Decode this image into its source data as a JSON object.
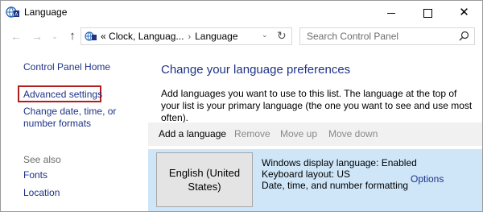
{
  "window": {
    "title": "Language",
    "controls": {
      "minimize": "",
      "maximize": "",
      "close": "✕"
    }
  },
  "navigation": {
    "back": "←",
    "forward": "→",
    "recent": "⌄",
    "up": "↑",
    "address": {
      "prefix": "«",
      "crumbs": [
        "Clock, Languag...",
        "Language"
      ],
      "separator": "›",
      "dropdown": "⌄",
      "refresh": "↻"
    },
    "search": {
      "placeholder": "Search Control Panel"
    }
  },
  "sidebar": {
    "home": "Control Panel Home",
    "advanced_settings": "Advanced settings",
    "change_date": "Change date, time, or number formats",
    "see_also": "See also",
    "fonts": "Fonts",
    "location": "Location"
  },
  "main": {
    "heading": "Change your language preferences",
    "description": "Add languages you want to use to this list. The language at the top of your list is your primary language (the one you want to see and use most often).",
    "toolbar": {
      "add": "Add a language",
      "remove": "Remove",
      "move_up": "Move up",
      "move_down": "Move down"
    },
    "languages": [
      {
        "name": "English (United States)",
        "details": [
          "Windows display language: Enabled",
          "Keyboard layout: US",
          "Date, time, and number formatting"
        ],
        "options_label": "Options"
      }
    ]
  },
  "colors": {
    "link": "#1e3287",
    "highlight_border": "#b01e1e",
    "selected_row": "#cfe6f8",
    "toolbar_bg": "#f1f1f1"
  }
}
